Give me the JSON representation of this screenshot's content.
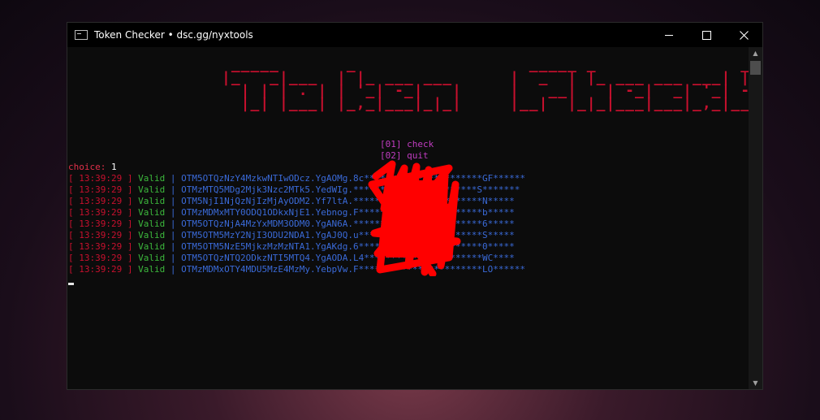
{
  "window": {
    "title": "Token Checker • dsc.gg/nyxtools",
    "minimize_label": "–",
    "maximize_label": "□",
    "close_label": "✕"
  },
  "console": {
    "banner": " _____       _                  _____ _               _\n|_   _|___  | |_ ___ ___      |  _  | |_ ___ ___ ___| |_ ___ ___\n  | | | . | | '_| -_|   |     |   __|   | -_|  _| '_| -_|  _|\n  |_| |___| |_,_|___|_|_|     |__|  |_|_|___|___|_,_|___|_|",
    "menu": [
      "[01] check",
      "[02] quit"
    ],
    "choice_label": "choice:",
    "choice_value": "1",
    "logs": [
      {
        "time": "13:39:29",
        "status": "Valid",
        "token": "OTM5OTQzNzY4MzkwNTIwODcz.YgAOMg.8c**********************GF******"
      },
      {
        "time": "13:39:29",
        "status": "Valid",
        "token": "OTMzMTQ5MDg2Mjk3Nzc2MTk5.YedWIg.***********************S*******"
      },
      {
        "time": "13:39:29",
        "status": "Valid",
        "token": "OTM5NjI1NjQzNjIzMjAyODM2.Yf7ltA.************************N*****"
      },
      {
        "time": "13:39:29",
        "status": "Valid",
        "token": "OTMzMDMxMTY0ODQ1ODkxNjE1.Yebnog.F***********************b*****"
      },
      {
        "time": "13:39:29",
        "status": "Valid",
        "token": "OTM5OTQzNjA4MzYxMDM3ODM0.YgAN6A.************************6*****"
      },
      {
        "time": "13:39:29",
        "status": "Valid",
        "token": "OTM5OTM5MzY2NjI3ODU2NDA1.YgAJ0Q.u***********************S*****"
      },
      {
        "time": "13:39:29",
        "status": "Valid",
        "token": "OTM5OTM5NzE5MjkzMzMzNTA1.YgAKdg.6***********************0*****"
      },
      {
        "time": "13:39:29",
        "status": "Valid",
        "token": "OTM5OTQzNTQ2ODkzNTI5MTQ4.YgAODA.L4**********************WC****"
      },
      {
        "time": "13:39:29",
        "status": "Valid",
        "token": "OTMzMDMxOTY4MDU5MzE4MzMy.YebpVw.F***********************LO******"
      }
    ]
  },
  "colors": {
    "banner": "#c8102e",
    "menu": "#c03cc0",
    "valid": "#3cb83c",
    "token": "#3a6ad8",
    "redaction": "#ff0000"
  },
  "icons": {
    "app": "console-icon",
    "scroll_up": "triangle-up-icon",
    "scroll_down": "triangle-down-icon"
  }
}
